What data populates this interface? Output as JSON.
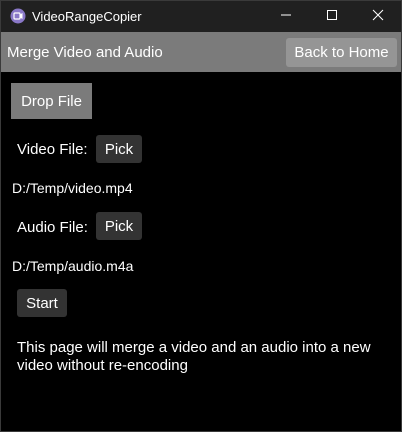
{
  "window": {
    "title": "VideoRangeCopier",
    "icons": {
      "app": "app-logo-icon",
      "minimize": "minimize-icon",
      "maximize": "maximize-icon",
      "close": "close-icon"
    }
  },
  "header": {
    "title": "Merge Video and Audio",
    "back_label": "Back to Home"
  },
  "main": {
    "drop_label": "Drop File",
    "video": {
      "label": "Video File:",
      "pick_label": "Pick",
      "path": "D:/Temp/video.mp4"
    },
    "audio": {
      "label": "Audio File:",
      "pick_label": "Pick",
      "path": "D:/Temp/audio.m4a"
    },
    "start_label": "Start",
    "description": "This page will merge a video and an audio into a new video without re-encoding"
  },
  "colors": {
    "background": "#000000",
    "titlebar": "#202020",
    "header": "#7b7b7b",
    "accent_button": "#959595",
    "dark_button": "#333333",
    "app_icon": "#8a78c8"
  }
}
